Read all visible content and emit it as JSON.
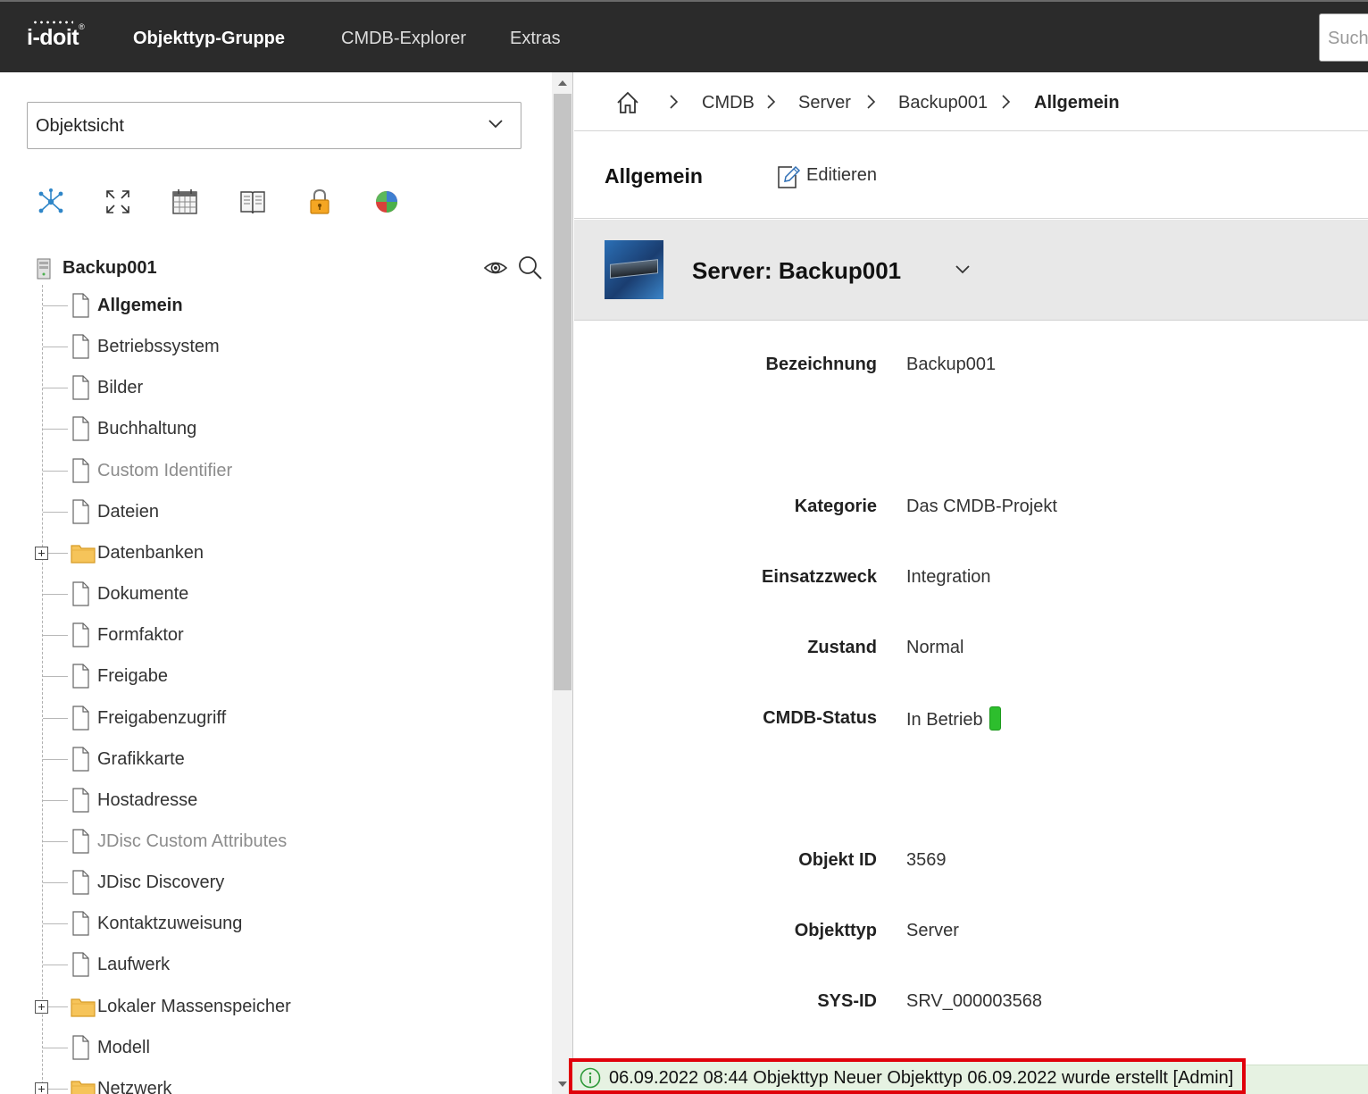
{
  "topbar": {
    "logo": "i-doit",
    "nav": [
      "Objekttyp-Gruppe",
      "CMDB-Explorer",
      "Extras"
    ],
    "search_placeholder": "Suche"
  },
  "sidebar": {
    "view_select": "Objektsicht",
    "toolbar_icons": [
      "network-icon",
      "expand-icon",
      "calendar-icon",
      "book-icon",
      "lock-icon",
      "pie-chart-icon"
    ],
    "root": "Backup001",
    "items": [
      {
        "label": "Allgemein",
        "icon": "file-icon",
        "style": "bold"
      },
      {
        "label": "Betriebssystem",
        "icon": "file-icon",
        "style": "normal"
      },
      {
        "label": "Bilder",
        "icon": "file-icon",
        "style": "normal"
      },
      {
        "label": "Buchhaltung",
        "icon": "file-icon",
        "style": "normal"
      },
      {
        "label": "Custom Identifier",
        "icon": "file-icon",
        "style": "grey"
      },
      {
        "label": "Dateien",
        "icon": "file-icon",
        "style": "normal"
      },
      {
        "label": "Datenbanken",
        "icon": "folder-icon",
        "style": "normal",
        "expandable": true
      },
      {
        "label": "Dokumente",
        "icon": "file-icon",
        "style": "normal"
      },
      {
        "label": "Formfaktor",
        "icon": "file-icon",
        "style": "normal"
      },
      {
        "label": "Freigabe",
        "icon": "file-icon",
        "style": "normal"
      },
      {
        "label": "Freigabenzugriff",
        "icon": "file-icon",
        "style": "normal"
      },
      {
        "label": "Grafikkarte",
        "icon": "file-icon",
        "style": "normal"
      },
      {
        "label": "Hostadresse",
        "icon": "file-icon",
        "style": "normal"
      },
      {
        "label": "JDisc Custom Attributes",
        "icon": "file-icon",
        "style": "grey"
      },
      {
        "label": "JDisc Discovery",
        "icon": "file-icon",
        "style": "normal"
      },
      {
        "label": "Kontaktzuweisung",
        "icon": "file-icon",
        "style": "normal"
      },
      {
        "label": "Laufwerk",
        "icon": "file-icon",
        "style": "normal"
      },
      {
        "label": "Lokaler Massenspeicher",
        "icon": "folder-icon",
        "style": "normal",
        "expandable": true
      },
      {
        "label": "Modell",
        "icon": "file-icon",
        "style": "normal"
      },
      {
        "label": "Netzwerk",
        "icon": "folder-icon",
        "style": "normal",
        "expandable": true
      }
    ]
  },
  "breadcrumb": [
    "CMDB",
    "Server",
    "Backup001",
    "Allgemein"
  ],
  "content": {
    "title": "Allgemein",
    "edit_label": "Editieren",
    "object_title": "Server: Backup001",
    "fields": [
      {
        "label": "Bezeichnung",
        "value": "Backup001"
      },
      {
        "label": "Kategorie",
        "value": "Das CMDB-Projekt"
      },
      {
        "label": "Einsatzzweck",
        "value": "Integration"
      },
      {
        "label": "Zustand",
        "value": "Normal"
      },
      {
        "label": "CMDB-Status",
        "value": "In Betrieb"
      },
      {
        "label": "Objekt ID",
        "value": "3569"
      },
      {
        "label": "Objekttyp",
        "value": "Server"
      },
      {
        "label": "SYS-ID",
        "value": "SRV_000003568"
      }
    ],
    "status_color": "#2dbe2d"
  },
  "message": "06.09.2022 08:44 Objekttyp Neuer Objekttyp 06.09.2022 wurde erstellt [Admin]",
  "colors": {
    "topbar": "#2b2b2b",
    "highlight": "#e0000a",
    "folder": "#f6c45a"
  }
}
